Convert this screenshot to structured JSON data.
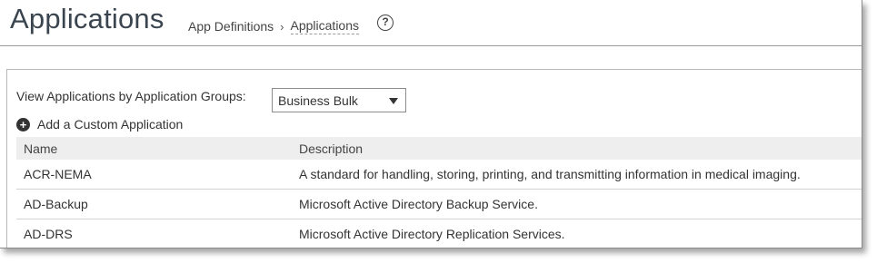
{
  "header": {
    "title": "Applications",
    "breadcrumb": {
      "parent": "App Definitions",
      "separator": "›",
      "current": "Applications"
    },
    "help_glyph": "?"
  },
  "filter": {
    "label": "View Applications by Application Groups:",
    "selected": "Business Bulk"
  },
  "add_custom": {
    "label": "Add a Custom Application",
    "icon": "plus-circle-icon"
  },
  "table": {
    "columns": [
      "Name",
      "Description"
    ],
    "rows": [
      {
        "name": "ACR-NEMA",
        "description": "A standard for handling, storing, printing, and transmitting information in medical imaging."
      },
      {
        "name": "AD-Backup",
        "description": "Microsoft Active Directory Backup Service."
      },
      {
        "name": "AD-DRS",
        "description": "Microsoft Active Directory Replication Services."
      }
    ]
  }
}
